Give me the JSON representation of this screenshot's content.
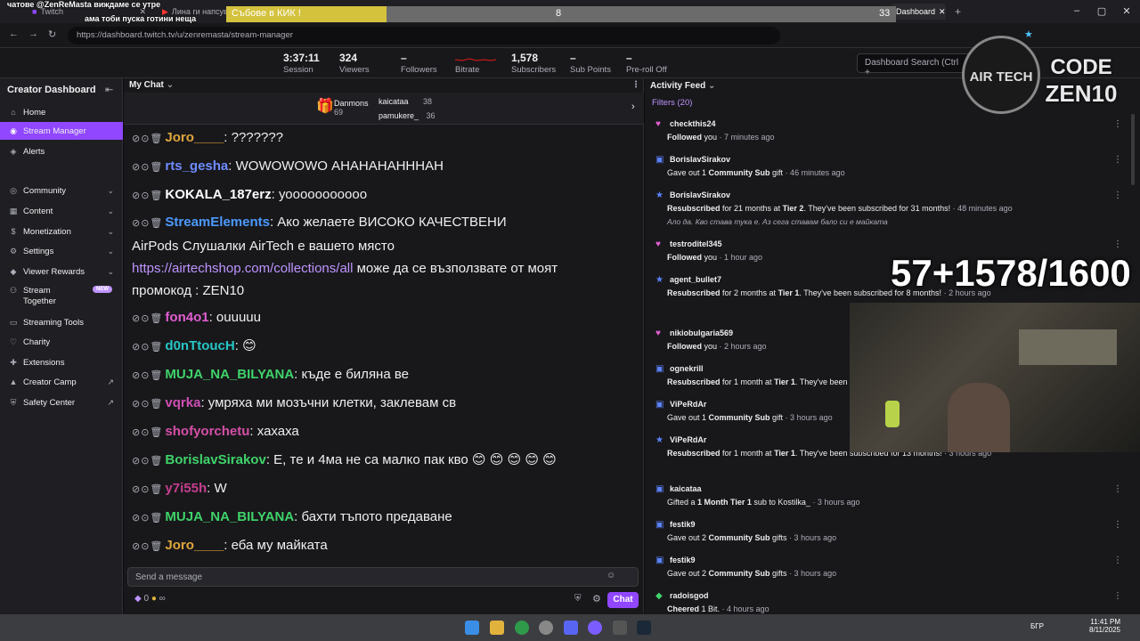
{
  "browser": {
    "tabs": [
      {
        "label": "Twitch"
      },
      {
        "label": "Лина ги напсува"
      },
      {
        "label": "Dashboard"
      }
    ],
    "url": "https://dashboard.twitch.tv/u/zenremasta/stream-manager"
  },
  "overlay": {
    "top_ticker": "чатове @ZenReMasta виждаме се утре",
    "top_ticker2": "ама тоби пуска готини неща",
    "banner_title": "Събове в КИК !",
    "banner_left_num": "8",
    "banner_right_num": "33",
    "sub_counter": "57+1578/1600",
    "logo_text": "AIR TECH",
    "code_label": "CODE",
    "code_value": "ZEN10"
  },
  "header": {
    "stats": [
      {
        "value": "3:37:11",
        "label": "Session"
      },
      {
        "value": "324",
        "label": "Viewers"
      },
      {
        "value": "–",
        "label": "Followers"
      },
      {
        "value": "",
        "label": "Bitrate"
      },
      {
        "value": "1,578",
        "label": "Subscribers"
      },
      {
        "value": "–",
        "label": "Sub Points"
      },
      {
        "value": "–",
        "label": "Pre-roll Off"
      }
    ],
    "search_placeholder": "Dashboard Search (Ctrl +"
  },
  "sidebar": {
    "title": "Creator Dashboard",
    "items": [
      {
        "label": "Home"
      },
      {
        "label": "Stream Manager"
      },
      {
        "label": "Alerts"
      },
      {
        "label": "Community"
      },
      {
        "label": "Content"
      },
      {
        "label": "Monetization"
      },
      {
        "label": "Settings"
      },
      {
        "label": "Viewer Rewards"
      },
      {
        "label": "Stream Together",
        "badge": "NEW"
      },
      {
        "label": "Streaming Tools"
      },
      {
        "label": "Charity"
      },
      {
        "label": "Extensions"
      },
      {
        "label": "Creator Camp"
      },
      {
        "label": "Safety Center"
      }
    ]
  },
  "chat": {
    "title": "My Chat",
    "hype": [
      {
        "name": "Danmons",
        "count": "69"
      },
      {
        "name": "kaicataa",
        "count": "38"
      },
      {
        "name": "pamukere_",
        "count": "36"
      }
    ],
    "messages": [
      {
        "user": "Joro____",
        "color": "#e0a63c",
        "text": ": ???????"
      },
      {
        "user": "rts_gesha",
        "color": "#6f8cff",
        "text": ": WOWOWOWO АНАНАНАНННАН"
      },
      {
        "user": "KOKALA_187erz",
        "color": "#ffffff",
        "text": ": уооооооооооо"
      },
      {
        "user": "StreamElements",
        "color": "#4c9aff",
        "text": ": Ако желаете ВИСОКО КАЧЕСТВЕНИ"
      },
      {
        "user": "",
        "color": "#efeff1",
        "text": "AirPods Слушалки AirTech е вашето място"
      },
      {
        "user": "",
        "color": "#bf94ff",
        "text": "https://airtechshop.com/collections/all",
        "tail": " може да се възползвате от моят"
      },
      {
        "user": "",
        "color": "#efeff1",
        "text": "промокод : ZEN10"
      },
      {
        "user": "fon4o1",
        "color": "#e05ed0",
        "text": ": оuuuuu"
      },
      {
        "user": "d0nTtoucH",
        "color": "#27c6c6",
        "text": ": 😊"
      },
      {
        "user": "MUJA_NA_BILYANA",
        "color": "#3fd36a",
        "text": ": къде е биляна ве"
      },
      {
        "user": "vqrka",
        "color": "#d04fb3",
        "text": ": умряха ми мозъчни клетки, заклевам св"
      },
      {
        "user": "shofyorchetu",
        "color": "#d44fa6",
        "text": ": хахаха"
      },
      {
        "user": "BorislavSirakov",
        "color": "#3fd36a",
        "text": ": Е, те и 4ма не са малко пак кво 😊 😊 😊 😊 😊"
      },
      {
        "user": "y7i55h",
        "color": "#c43f8e",
        "text": ": W"
      },
      {
        "user": "MUJA_NA_BILYANA",
        "color": "#3fd36a",
        "text": ": бахти тъпото предаване"
      },
      {
        "user": "Joro____",
        "color": "#e0a63c",
        "text": ": еба му майката"
      }
    ],
    "send_placeholder": "Send a message",
    "points": "0",
    "points_unit": "∞",
    "chat_button": "Chat"
  },
  "activity": {
    "title": "Activity Feed",
    "filters": "Filters (20)",
    "items": [
      {
        "icon": "heart",
        "name": "checkthis24",
        "action": "Followed",
        "rest": " you",
        "time": "· 7 minutes ago"
      },
      {
        "icon": "gift",
        "name": "BorislavSirakov",
        "action": "",
        "rest": "Gave out 1 ",
        "bold": "Community Sub",
        "rest2": " gift",
        "time": "· 46 minutes ago"
      },
      {
        "icon": "star",
        "name": "BorislavSirakov",
        "action": "Resubscribed",
        "rest": " for 21 months at ",
        "bold": "Tier 2",
        "rest2": ". They've been subscribed for 31 months!",
        "time": "· 48 minutes ago",
        "note": "Ало да. Кво става тука е. Аз сега ставам бало си е майката"
      },
      {
        "icon": "heart",
        "name": "testroditel345",
        "action": "Followed",
        "rest": " you",
        "time": "· 1 hour ago"
      },
      {
        "icon": "star",
        "name": "agent_bullet7",
        "action": "Resubscribed",
        "rest": " for 2 months at ",
        "bold": "Tier 1",
        "rest2": ". They've been subscribed for 8 months!",
        "time": "· 2 hours ago"
      },
      {
        "icon": "heart",
        "name": "nikiobulgaria569",
        "action": "Followed",
        "rest": " you",
        "time": "· 2 hours ago"
      },
      {
        "icon": "gift",
        "name": "ognekrill",
        "action": "Resubscribed",
        "rest": " for 1 month at ",
        "bold": "Tier 1",
        "rest2": ". They've been",
        "time": ""
      },
      {
        "icon": "gift",
        "name": "ViPeRdAr",
        "action": "",
        "rest": "Gave out 1 ",
        "bold": "Community Sub",
        "rest2": " gift",
        "time": "· 3 hours ago"
      },
      {
        "icon": "star",
        "name": "ViPeRdAr",
        "action": "Resubscribed",
        "rest": " for 1 month at ",
        "bold": "Tier 1",
        "rest2": ". They've been subscribed for 13 months!",
        "time": "· 3 hours ago"
      },
      {
        "icon": "gift",
        "name": "kaicataa",
        "action": "",
        "rest": "Gifted a ",
        "bold": "1 Month Tier 1",
        "rest2": " sub to Kostilka_",
        "time": "· 3 hours ago"
      },
      {
        "icon": "gift",
        "name": "festik9",
        "action": "",
        "rest": "Gave out 2 ",
        "bold": "Community Sub",
        "rest2": " gifts",
        "time": "· 3 hours ago"
      },
      {
        "icon": "gift",
        "name": "festik9",
        "action": "",
        "rest": "Gave out 2 ",
        "bold": "Community Sub",
        "rest2": " gifts",
        "time": "· 3 hours ago"
      },
      {
        "icon": "bits",
        "name": "radoisgod",
        "action": "Cheered",
        "rest": " 1 Bit.",
        "time": "· 4 hours ago"
      }
    ]
  },
  "taskbar": {
    "lang": "БГР",
    "time": "11:41 PM",
    "date": "8/11/2025"
  },
  "colors": {
    "accent": "#9147ff",
    "link": "#bf94ff",
    "heart": "#e05ed0",
    "gift": "#5c84ff"
  }
}
